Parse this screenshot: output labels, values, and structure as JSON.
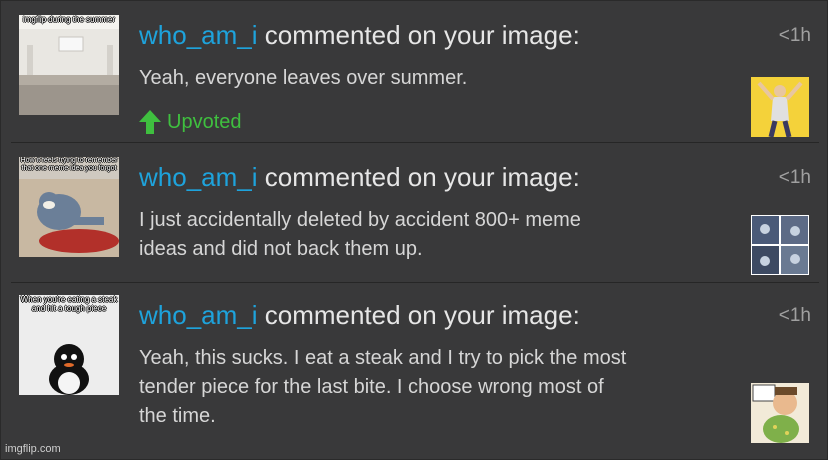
{
  "notifications": [
    {
      "thumb_caption": "imgflip during the summer",
      "username": "who_am_i",
      "action": " commented on your image:",
      "time": "<1h",
      "lines": [
        "Yeah, everyone leaves over summer."
      ],
      "vote_label": "Upvoted",
      "thumb_icon": "empty-room-image-icon",
      "avatar_icon": "comic-hero-avatar-icon"
    },
    {
      "thumb_caption": "How it feels trying to remember that one meme idea you forgot",
      "username": "who_am_i",
      "action": " commented on your image:",
      "time": "<1h",
      "lines": [
        "I just accidentally deleted by accident 800+ meme",
        "ideas and did not back them up."
      ],
      "thumb_icon": "cartoon-cat-image-icon",
      "avatar_icon": "comic-panels-avatar-icon"
    },
    {
      "thumb_caption": "When you're eating a steak and hit a tough piece",
      "username": "who_am_i",
      "action": " commented on your image:",
      "time": "<1h",
      "lines": [
        "Yeah, this sucks. I eat a steak and I try to pick the most",
        "tender piece for the last bite. I choose wrong most of",
        "the time."
      ],
      "thumb_icon": "penguin-image-icon",
      "avatar_icon": "cartoon-character-avatar-icon"
    }
  ],
  "watermark": "imgflip.com",
  "colors": {
    "background": "#39393a",
    "username": "#1ea3dc",
    "upvote": "#3fbf3f",
    "text": "#d6d6d6"
  }
}
